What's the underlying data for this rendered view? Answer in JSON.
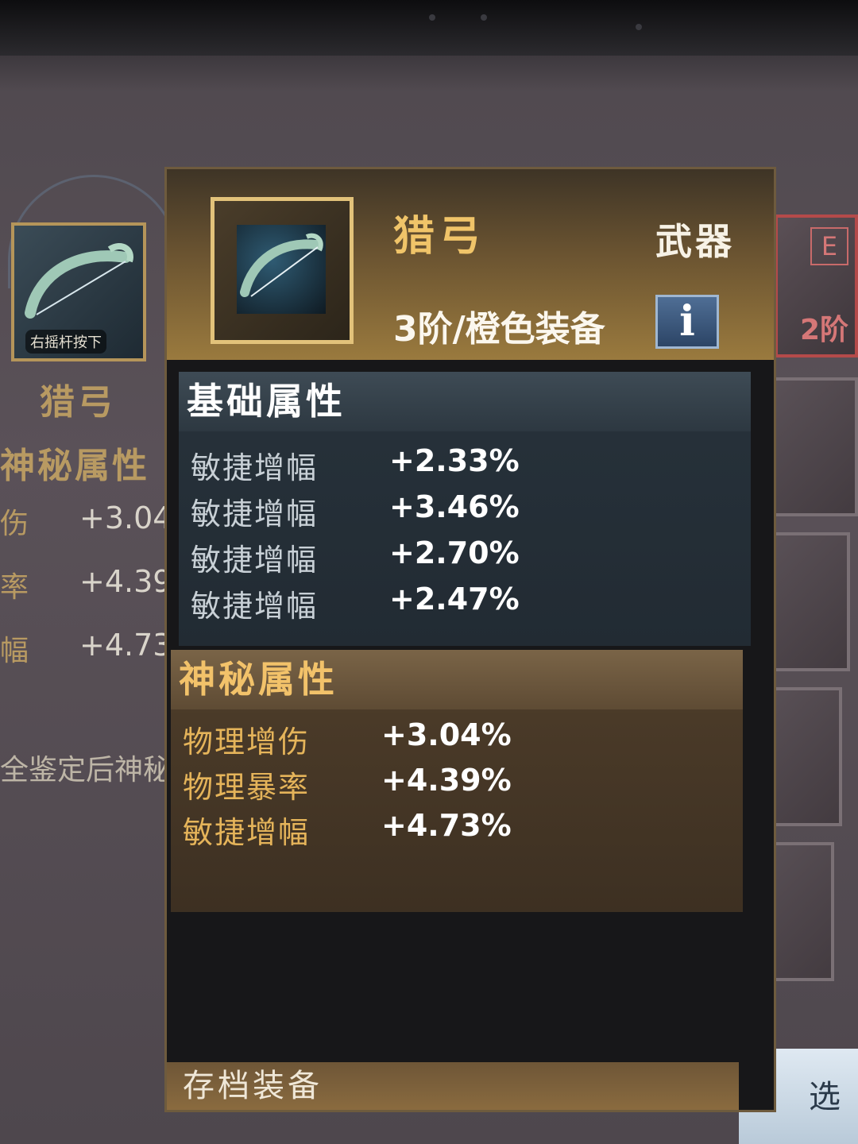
{
  "left_panel": {
    "slot_hint": "右摇杆按下",
    "item_name": "猎弓",
    "section_title": "神秘属性",
    "rows": [
      {
        "label": "伤",
        "value": "+3.04"
      },
      {
        "label": "率",
        "value": "+4.39"
      },
      {
        "label": "幅",
        "value": "+4.73"
      }
    ],
    "note": "全鉴定后神秘"
  },
  "right_panel": {
    "card_letter": "E",
    "card_tier": "2阶",
    "select_label": "选"
  },
  "tooltip": {
    "item_name": "猎弓",
    "item_type": "武器",
    "tier": "3阶/橙色装备",
    "info_icon": "i",
    "basic": {
      "title": "基础属性",
      "stats": [
        {
          "label": "敏捷增幅",
          "value": "+2.33%"
        },
        {
          "label": "敏捷增幅",
          "value": "+3.46%"
        },
        {
          "label": "敏捷增幅",
          "value": "+2.70%"
        },
        {
          "label": "敏捷增幅",
          "value": "+2.47%"
        }
      ]
    },
    "mystic": {
      "title": "神秘属性",
      "stats": [
        {
          "label": "物理增伤",
          "value": "+3.04%"
        },
        {
          "label": "物理暴率",
          "value": "+4.39%"
        },
        {
          "label": "敏捷增幅",
          "value": "+4.73%"
        }
      ]
    },
    "footer": "存档装备"
  },
  "colors": {
    "gold": "#f0c469",
    "mystic_label": "#e5b45a",
    "basic_bg": "#27323b",
    "tier_red": "#d57777"
  },
  "icons": [
    "bow-icon",
    "info-icon"
  ]
}
